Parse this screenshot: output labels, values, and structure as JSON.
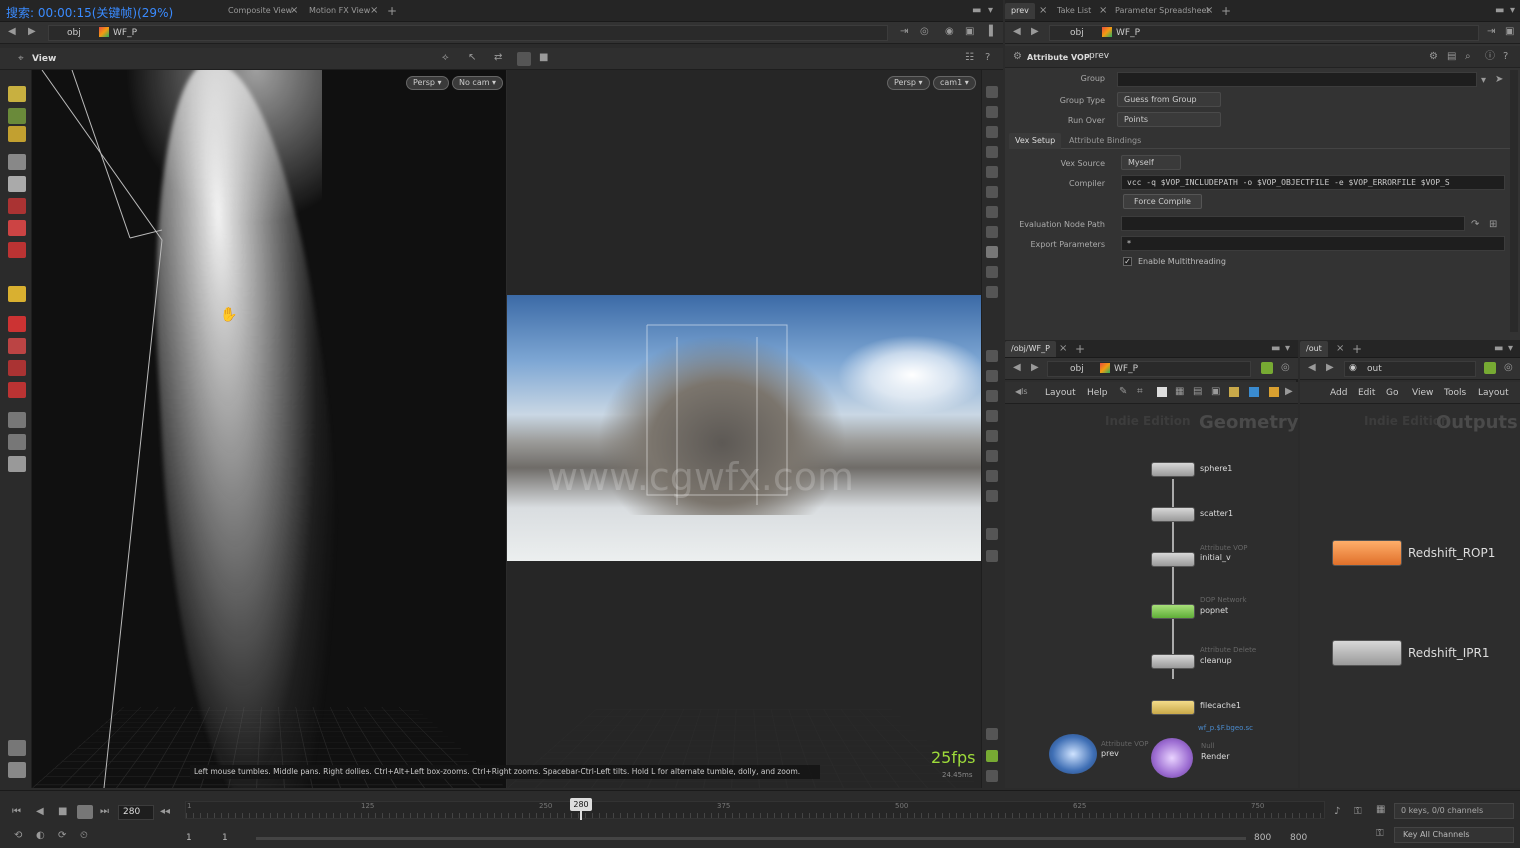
{
  "overlay_text": "搜索: 00:00:15(关键帧)(29%)",
  "left_tabs": [
    "Composite View",
    "Motion FX View"
  ],
  "right_tabs": [
    "prev",
    "Take List",
    "Parameter Spreadsheet"
  ],
  "path": {
    "root": "obj",
    "node": "WF_P"
  },
  "viewport": {
    "view_label": "View",
    "left_cam": {
      "persp": "Persp ▾",
      "cam": "No cam ▾"
    },
    "right_cam": {
      "persp": "Persp ▾",
      "cam": "cam1 ▾"
    },
    "fps": "25fps",
    "fps_sub": "24.45ms",
    "hint": "Left mouse tumbles. Middle pans. Right dollies. Ctrl+Alt+Left box-zooms. Ctrl+Right zooms. Spacebar-Ctrl-Left tilts. Hold L for alternate tumble, dolly, and zoom.",
    "watermark": "www.cgwfx.com"
  },
  "parms": {
    "node_type": "Attribute VOP",
    "node_name": "prev",
    "group_label": "Group",
    "group_type_label": "Group Type",
    "group_type_value": "Guess from Group",
    "run_over_label": "Run Over",
    "run_over_value": "Points",
    "tabs": [
      "Vex Setup",
      "Attribute Bindings"
    ],
    "vex_source_label": "Vex Source",
    "vex_source_value": "Myself",
    "compiler_label": "Compiler",
    "compiler_value": "vcc -q $VOP_INCLUDEPATH -o $VOP_OBJECTFILE -e $VOP_ERRORFILE $VOP_S",
    "force_compile": "Force Compile",
    "eval_path_label": "Evaluation Node Path",
    "export_label": "Export Parameters",
    "export_value": "*",
    "multithread_label": "Enable Multithreading"
  },
  "net_left": {
    "tab": "/obj/WF_P",
    "path_root": "obj",
    "path_node": "WF_P",
    "menu": [
      "Layout",
      "Help"
    ],
    "watermark_a": "Indie Edition",
    "watermark_b": "Geometry",
    "nodes": [
      {
        "name": "sphere1",
        "sub": ""
      },
      {
        "name": "scatter1",
        "sub": ""
      },
      {
        "name": "initial_v",
        "sub": "Attribute VOP"
      },
      {
        "name": "popnet",
        "sub": "DOP Network"
      },
      {
        "name": "cleanup",
        "sub": "Attribute Delete"
      },
      {
        "name": "filecache1",
        "sub": "",
        "extra": "wf_p.$F.bgeo.sc"
      },
      {
        "name": "prev",
        "sub": "Attribute VOP"
      },
      {
        "name": "Render",
        "sub": "Null"
      }
    ]
  },
  "net_right": {
    "tab": "/out",
    "path_node": "out",
    "menu": [
      "Add",
      "Edit",
      "Go",
      "View",
      "Tools",
      "Layout"
    ],
    "watermark_a": "Indie Edition",
    "watermark_b": "Outputs",
    "nodes": [
      {
        "name": "Redshift_ROP1"
      },
      {
        "name": "Redshift_IPR1"
      }
    ]
  },
  "timeline": {
    "frame": "280",
    "marker": "280",
    "ticks": [
      "1",
      "125",
      "250",
      "375",
      "500",
      "625",
      "750"
    ],
    "start": "1",
    "start2": "1",
    "end": "800",
    "end2": "800",
    "keys": "0 keys, 0/0 channels",
    "key_all": "Key All Channels"
  }
}
